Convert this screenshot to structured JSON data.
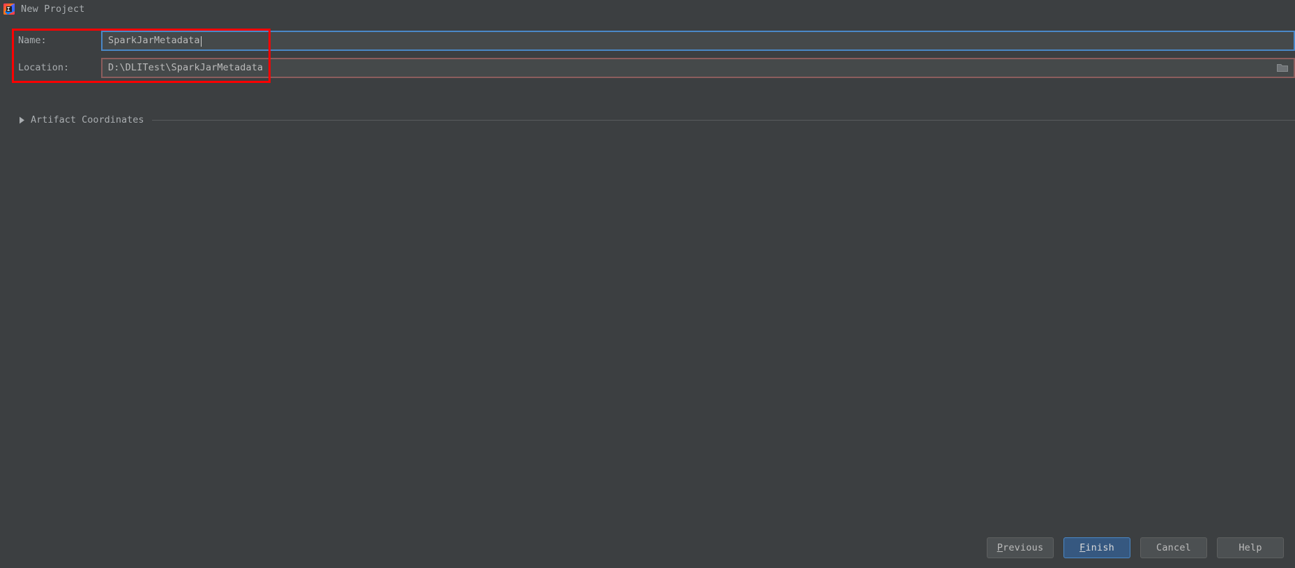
{
  "window": {
    "title": "New Project",
    "icon": "intellij-idea-icon",
    "background_color": "#3c3f41"
  },
  "form": {
    "fields": [
      {
        "label": "Name:",
        "value": "SparkJarMetadata",
        "state": "focused",
        "border_color": "#4a88c7",
        "has_caret": true
      },
      {
        "label": "Location:",
        "value": "D:\\DLITest\\SparkJarMetadata",
        "state": "error",
        "border_color": "#8c5d5d",
        "has_caret": false,
        "browse_icon": "folder-icon"
      }
    ],
    "collapsible": {
      "label": "Artifact Coordinates",
      "expanded": false,
      "icon": "triangle-right-icon"
    }
  },
  "annotation": {
    "color": "#ff0000",
    "shape": "rectangle"
  },
  "buttons": [
    {
      "label": "Previous",
      "mnemonic": "P",
      "rest": "revious",
      "primary": false
    },
    {
      "label": "Finish",
      "mnemonic": "F",
      "rest": "inish",
      "primary": true
    },
    {
      "label": "Cancel",
      "mnemonic": "",
      "rest": "Cancel",
      "primary": false
    },
    {
      "label": "Help",
      "mnemonic": "",
      "rest": "Help",
      "primary": false
    }
  ]
}
